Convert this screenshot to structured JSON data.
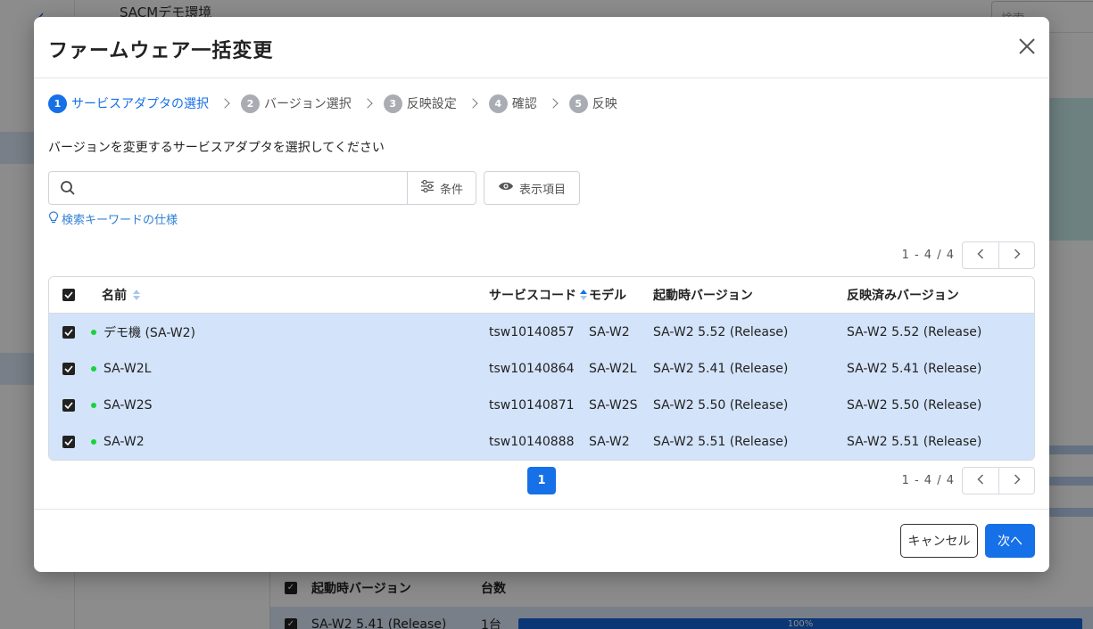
{
  "background": {
    "app_title": "SACMデモ環境",
    "search_placeholder": "検索",
    "panel": {
      "col_boot_version": "起動時バージョン",
      "col_count": "台数",
      "row_version": "SA-W2 5.41 (Release)",
      "row_count": "1台",
      "row_percent": "100%"
    }
  },
  "modal": {
    "title": "ファームウェア一括変更",
    "steps": [
      {
        "num": "1",
        "label": "サービスアダプタの選択",
        "active": true
      },
      {
        "num": "2",
        "label": "バージョン選択",
        "active": false
      },
      {
        "num": "3",
        "label": "反映設定",
        "active": false
      },
      {
        "num": "4",
        "label": "確認",
        "active": false
      },
      {
        "num": "5",
        "label": "反映",
        "active": false
      }
    ],
    "instruction": "バージョンを変更するサービスアダプタを選択してください",
    "search": {
      "value": "",
      "placeholder": ""
    },
    "condition_label": "条件",
    "view_items_label": "表示項目",
    "keyword_spec_link": "検索キーワードの仕様",
    "pagination": {
      "info": "1 - 4 / 4",
      "current_page": "1"
    },
    "table": {
      "headers": {
        "name": "名前",
        "service_code": "サービスコード",
        "model": "モデル",
        "boot_version": "起動時バージョン",
        "applied_version": "反映済みバージョン"
      },
      "rows": [
        {
          "name": "デモ機 (SA-W2)",
          "code": "tsw10140857",
          "model": "SA-W2",
          "boot": "SA-W2 5.52 (Release)",
          "applied": "SA-W2 5.52 (Release)",
          "checked": true,
          "status": "online"
        },
        {
          "name": "SA-W2L",
          "code": "tsw10140864",
          "model": "SA-W2L",
          "boot": "SA-W2 5.41 (Release)",
          "applied": "SA-W2 5.41 (Release)",
          "checked": true,
          "status": "online"
        },
        {
          "name": "SA-W2S",
          "code": "tsw10140871",
          "model": "SA-W2S",
          "boot": "SA-W2 5.50 (Release)",
          "applied": "SA-W2 5.50 (Release)",
          "checked": true,
          "status": "online"
        },
        {
          "name": "SA-W2",
          "code": "tsw10140888",
          "model": "SA-W2",
          "boot": "SA-W2 5.51 (Release)",
          "applied": "SA-W2 5.51 (Release)",
          "checked": true,
          "status": "online"
        }
      ]
    },
    "footer": {
      "cancel_label": "キャンセル",
      "next_label": "次へ"
    }
  },
  "colors": {
    "accent": "#1670e8",
    "row_selected": "#d3e3fa",
    "status_online": "#18d23c"
  }
}
